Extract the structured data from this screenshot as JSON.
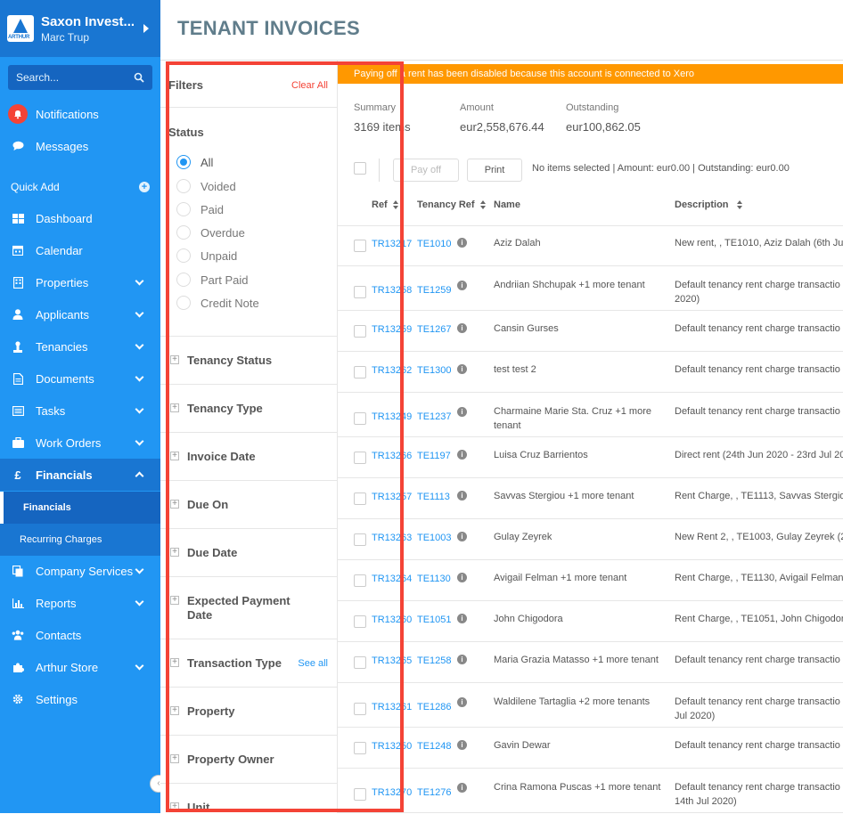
{
  "account": {
    "name": "Saxon Invest...",
    "user": "Marc Trup",
    "logo_text": "ARTHUR"
  },
  "search": {
    "placeholder": "Search..."
  },
  "nav": {
    "notifications": "Notifications",
    "messages": "Messages",
    "quick_add": "Quick Add",
    "items": [
      {
        "label": "Dashboard",
        "icon": "dashboard-icon"
      },
      {
        "label": "Calendar",
        "icon": "calendar-icon"
      },
      {
        "label": "Properties",
        "icon": "properties-icon"
      },
      {
        "label": "Applicants",
        "icon": "user-icon"
      },
      {
        "label": "Tenancies",
        "icon": "tenancies-icon"
      },
      {
        "label": "Documents",
        "icon": "document-icon"
      },
      {
        "label": "Tasks",
        "icon": "tasks-icon"
      },
      {
        "label": "Work Orders",
        "icon": "briefcase-icon"
      },
      {
        "label": "Financials",
        "icon": "pound-icon"
      },
      {
        "label": "Company Services",
        "icon": "copy-icon"
      },
      {
        "label": "Reports",
        "icon": "chart-icon"
      },
      {
        "label": "Contacts",
        "icon": "contacts-icon"
      },
      {
        "label": "Arthur Store",
        "icon": "puzzle-icon"
      },
      {
        "label": "Settings",
        "icon": "gear-icon"
      }
    ],
    "financials_sub": [
      "Financials",
      "Recurring Charges"
    ],
    "financials_symbol": "£"
  },
  "page_title": "TENANT INVOICES",
  "filters": {
    "title": "Filters",
    "clear_all": "Clear All",
    "status_title": "Status",
    "status_options": [
      "All",
      "Voided",
      "Paid",
      "Overdue",
      "Unpaid",
      "Part Paid",
      "Credit Note"
    ],
    "selected_status": "All",
    "sections": [
      "Tenancy Status",
      "Tenancy Type",
      "Invoice Date",
      "Due On",
      "Due Date",
      "Expected Payment Date",
      "Transaction Type",
      "Property",
      "Property Owner",
      "Unit"
    ],
    "see_all": "See all"
  },
  "banner": "Paying off a rent has been disabled because this account is connected to Xero",
  "summary": {
    "summary_label": "Summary",
    "summary_value": "3169 items",
    "amount_label": "Amount",
    "amount_value": "eur2,558,676.44",
    "outstanding_label": "Outstanding",
    "outstanding_value": "eur100,862.05"
  },
  "toolbar": {
    "pay_off": "Pay off",
    "print": "Print",
    "selection_info": "No items selected | Amount: eur0.00 | Outstanding: eur0.00"
  },
  "table": {
    "headers": {
      "ref": "Ref",
      "tenancy_ref": "Tenancy Ref",
      "name": "Name",
      "description": "Description"
    },
    "rows": [
      {
        "ref": "TR13217",
        "tref": "TE1010",
        "name": "Aziz Dalah",
        "desc": "New rent, , TE1010, Aziz Dalah (6th Jul"
      },
      {
        "ref": "TR13258",
        "tref": "TE1259",
        "name": "Andriian Shchupak +1 more tenant",
        "desc": "Default tenancy rent charge transactio",
        "desc2": "2020)"
      },
      {
        "ref": "TR13259",
        "tref": "TE1267",
        "name": "Cansin Gurses",
        "desc": "Default tenancy rent charge transactio"
      },
      {
        "ref": "TR13262",
        "tref": "TE1300",
        "name": "test test 2",
        "desc": "Default tenancy rent charge transactio"
      },
      {
        "ref": "TR13249",
        "tref": "TE1237",
        "name": "Charmaine Marie Sta. Cruz +1 more tenant",
        "desc": "Default tenancy rent charge transactio"
      },
      {
        "ref": "TR13266",
        "tref": "TE1197",
        "name": "Luisa Cruz Barrientos",
        "desc": "Direct rent (24th Jun 2020 - 23rd Jul 20"
      },
      {
        "ref": "TR13257",
        "tref": "TE1113",
        "name": "Savvas Stergiou +1 more tenant",
        "desc": "Rent Charge, , TE1113, Savvas Stergiou"
      },
      {
        "ref": "TR13263",
        "tref": "TE1003",
        "name": "Gulay Zeyrek",
        "desc": "New Rent 2, , TE1003, Gulay Zeyrek (2"
      },
      {
        "ref": "TR13264",
        "tref": "TE1130",
        "name": "Avigail Felman +1 more tenant",
        "desc": "Rent Charge, , TE1130, Avigail Felman"
      },
      {
        "ref": "TR13260",
        "tref": "TE1051",
        "name": "John Chigodora",
        "desc": "Rent Charge, , TE1051, John Chigodora"
      },
      {
        "ref": "TR13265",
        "tref": "TE1258",
        "name": "Maria Grazia Matasso +1 more tenant",
        "desc": "Default tenancy rent charge transactio"
      },
      {
        "ref": "TR13261",
        "tref": "TE1286",
        "name": "Waldilene Tartaglia +2 more tenants",
        "desc": "Default tenancy rent charge transactio",
        "desc2": "Jul 2020)"
      },
      {
        "ref": "TR13250",
        "tref": "TE1248",
        "name": "Gavin Dewar",
        "desc": "Default tenancy rent charge transactio"
      },
      {
        "ref": "TR13270",
        "tref": "TE1276",
        "name": "Crina Ramona Puscas +1 more tenant",
        "desc": "Default tenancy rent charge transactio",
        "desc2": "14th Jul 2020)"
      }
    ]
  },
  "colors": {
    "sidebar": "#2196f3",
    "banner": "#ff9800",
    "highlight": "#f44336",
    "link": "#2196f3"
  }
}
